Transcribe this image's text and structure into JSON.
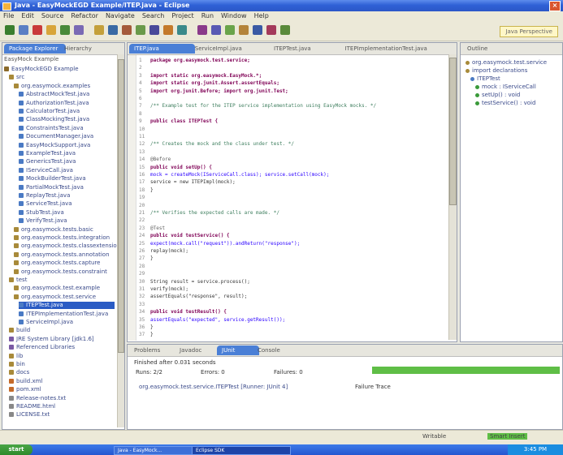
{
  "window": {
    "title": "Java - EasyMockEGD Example/ITEP.java - Eclipse",
    "close_glyph": "×"
  },
  "menu": [
    "File",
    "Edit",
    "Source",
    "Refactor",
    "Navigate",
    "Search",
    "Project",
    "Run",
    "Window",
    "Help"
  ],
  "toolbar": {
    "perspective_label": "Java Perspective",
    "button_colors": [
      "#3b7f2e",
      "#5a7fc4",
      "#c93a3a",
      "#d8a53a",
      "#4a8a3a",
      "#7a6ab4",
      "#c4a03a",
      "#3a6aa4",
      "#a45a3a",
      "#6a9a4a",
      "#4a4a9a",
      "#c47a2a",
      "#3a8a8a",
      "#8a3a8a",
      "#5a5ab4",
      "#6aa44a",
      "#b4843a",
      "#3a5aa4",
      "#a43a5a",
      "#5a8a3a"
    ]
  },
  "left_panel": {
    "tabs": [
      "Package Explorer",
      "Hierarchy"
    ],
    "header": "EasyMock Example",
    "tree": [
      {
        "label": "EasyMockEGD Example",
        "indent": 0,
        "color": "#8a6a2a"
      },
      {
        "label": "src",
        "indent": 1,
        "color": "#a88a3a"
      },
      {
        "label": "org.easymock.examples",
        "indent": 2,
        "color": "#a88a3a"
      },
      {
        "label": "AbstractMockTest.java",
        "indent": 3,
        "color": "#4a7ac4"
      },
      {
        "label": "AuthorizationTest.java",
        "indent": 3,
        "color": "#4a7ac4"
      },
      {
        "label": "CalculatorTest.java",
        "indent": 3,
        "color": "#4a7ac4"
      },
      {
        "label": "ClassMockingTest.java",
        "indent": 3,
        "color": "#4a7ac4"
      },
      {
        "label": "ConstraintsTest.java",
        "indent": 3,
        "color": "#4a7ac4"
      },
      {
        "label": "DocumentManager.java",
        "indent": 3,
        "color": "#4a7ac4"
      },
      {
        "label": "EasyMockSupport.java",
        "indent": 3,
        "color": "#4a7ac4"
      },
      {
        "label": "ExampleTest.java",
        "indent": 3,
        "color": "#4a7ac4"
      },
      {
        "label": "GenericsTest.java",
        "indent": 3,
        "color": "#4a7ac4"
      },
      {
        "label": "IServiceCall.java",
        "indent": 3,
        "color": "#4a7ac4"
      },
      {
        "label": "MockBuilderTest.java",
        "indent": 3,
        "color": "#4a7ac4"
      },
      {
        "label": "PartialMockTest.java",
        "indent": 3,
        "color": "#4a7ac4"
      },
      {
        "label": "ReplayTest.java",
        "indent": 3,
        "color": "#4a7ac4"
      },
      {
        "label": "ServiceTest.java",
        "indent": 3,
        "color": "#4a7ac4"
      },
      {
        "label": "StubTest.java",
        "indent": 3,
        "color": "#4a7ac4"
      },
      {
        "label": "VerifyTest.java",
        "indent": 3,
        "color": "#4a7ac4"
      },
      {
        "label": "org.easymock.tests.basic",
        "indent": 2,
        "color": "#a88a3a"
      },
      {
        "label": "org.easymock.tests.integration",
        "indent": 2,
        "color": "#a88a3a"
      },
      {
        "label": "org.easymock.tests.classextension",
        "indent": 2,
        "color": "#a88a3a"
      },
      {
        "label": "org.easymock.tests.annotation",
        "indent": 2,
        "color": "#a88a3a"
      },
      {
        "label": "org.easymock.tests.capture",
        "indent": 2,
        "color": "#a88a3a"
      },
      {
        "label": "org.easymock.tests.constraint",
        "indent": 2,
        "color": "#a88a3a"
      },
      {
        "label": "test",
        "indent": 1,
        "color": "#a88a3a"
      },
      {
        "label": "org.easymock.test.example",
        "indent": 2,
        "color": "#a88a3a"
      },
      {
        "label": "org.easymock.test.service",
        "indent": 2,
        "color": "#a88a3a"
      },
      {
        "label": "ITEPTest.java",
        "indent": 3,
        "color": "#4a7ac4",
        "selected": true
      },
      {
        "label": "ITEPImplementationTest.java",
        "indent": 3,
        "color": "#4a7ac4"
      },
      {
        "label": "ServiceImpl.java",
        "indent": 3,
        "color": "#4a7ac4"
      },
      {
        "label": "build",
        "indent": 1,
        "color": "#a88a3a"
      },
      {
        "label": "JRE System Library [jdk1.6]",
        "indent": 1,
        "color": "#7a5aa4"
      },
      {
        "label": "Referenced Libraries",
        "indent": 1,
        "color": "#7a5aa4"
      },
      {
        "label": "lib",
        "indent": 1,
        "color": "#a88a3a"
      },
      {
        "label": "bin",
        "indent": 1,
        "color": "#a88a3a"
      },
      {
        "label": "docs",
        "indent": 1,
        "color": "#a88a3a"
      },
      {
        "label": "build.xml",
        "indent": 1,
        "color": "#c46a2a"
      },
      {
        "label": "pom.xml",
        "indent": 1,
        "color": "#c46a2a"
      },
      {
        "label": "Release-notes.txt",
        "indent": 1,
        "color": "#888"
      },
      {
        "label": "README.html",
        "indent": 1,
        "color": "#888"
      },
      {
        "label": "LICENSE.txt",
        "indent": 1,
        "color": "#888"
      }
    ]
  },
  "editor": {
    "tabs": [
      "ITEP.java",
      "ServiceImpl.java",
      "ITEPTest.java",
      "ITEPImplementationTest.java"
    ],
    "lines": [
      {
        "n": "1",
        "cls": "c-key",
        "text": "package org.easymock.test.service;"
      },
      {
        "n": "2",
        "cls": "c-def",
        "text": ""
      },
      {
        "n": "3",
        "cls": "c-key",
        "text": "import static org.easymock.EasyMock.*;"
      },
      {
        "n": "4",
        "cls": "c-key",
        "text": "import static org.junit.Assert.assertEquals;"
      },
      {
        "n": "5",
        "cls": "c-key",
        "text": "import org.junit.Before;   import org.junit.Test;"
      },
      {
        "n": "6",
        "cls": "c-def",
        "text": ""
      },
      {
        "n": "7",
        "cls": "c-comment",
        "text": "/** Example test for the ITEP service implementation using EasyMock mocks. */"
      },
      {
        "n": "8",
        "cls": "c-def",
        "text": ""
      },
      {
        "n": "9",
        "cls": "c-key",
        "text": "public class ITEPTest {"
      },
      {
        "n": "10",
        "cls": "c-def",
        "text": ""
      },
      {
        "n": "11",
        "cls": "c-def",
        "text": ""
      },
      {
        "n": "12",
        "cls": "c-comment",
        "text": "  /** Creates the mock and the class under test. */"
      },
      {
        "n": "13",
        "cls": "c-def",
        "text": ""
      },
      {
        "n": "14",
        "cls": "c-anno",
        "text": "  @Before"
      },
      {
        "n": "15",
        "cls": "c-key",
        "text": "  public void setUp() {"
      },
      {
        "n": "16",
        "cls": "c-str",
        "text": "    mock = createMock(IServiceCall.class); service.setCall(mock);"
      },
      {
        "n": "17",
        "cls": "c-def",
        "text": "    service = new ITEPImpl(mock);"
      },
      {
        "n": "18",
        "cls": "c-def",
        "text": "  }"
      },
      {
        "n": "19",
        "cls": "c-def",
        "text": ""
      },
      {
        "n": "20",
        "cls": "c-def",
        "text": ""
      },
      {
        "n": "21",
        "cls": "c-comment",
        "text": "  /** Verifies the expected calls are made. */"
      },
      {
        "n": "22",
        "cls": "c-def",
        "text": ""
      },
      {
        "n": "23",
        "cls": "c-anno",
        "text": "  @Test"
      },
      {
        "n": "24",
        "cls": "c-key",
        "text": "  public void testService() {"
      },
      {
        "n": "25",
        "cls": "c-str",
        "text": "    expect(mock.call(\"request\")).andReturn(\"response\");"
      },
      {
        "n": "26",
        "cls": "c-def",
        "text": "    replay(mock);"
      },
      {
        "n": "27",
        "cls": "c-def",
        "text": "  }"
      },
      {
        "n": "28",
        "cls": "c-def",
        "text": ""
      },
      {
        "n": "29",
        "cls": "c-def",
        "text": ""
      },
      {
        "n": "30",
        "cls": "c-def",
        "text": "    String result = service.process();"
      },
      {
        "n": "31",
        "cls": "c-def",
        "text": "    verify(mock);"
      },
      {
        "n": "32",
        "cls": "c-def",
        "text": "    assertEquals(\"response\", result);"
      },
      {
        "n": "33",
        "cls": "c-def",
        "text": ""
      },
      {
        "n": "34",
        "cls": "c-key",
        "text": "    public void testResult() {"
      },
      {
        "n": "35",
        "cls": "c-str",
        "text": "      assertEquals(\"expected\", service.getResult());"
      },
      {
        "n": "36",
        "cls": "c-def",
        "text": "    }"
      },
      {
        "n": "37",
        "cls": "c-def",
        "text": "}"
      }
    ]
  },
  "outline": {
    "tabs": [
      "Outline"
    ],
    "rows": [
      {
        "label": "org.easymock.test.service",
        "color": "#a88a3a"
      },
      {
        "label": "import declarations",
        "color": "#a88a3a"
      },
      {
        "label": "ITEPTest",
        "color": "#4a7ac4"
      },
      {
        "label": "mock : IServiceCall",
        "color": "#3a9a3a"
      },
      {
        "label": "setUp() : void",
        "color": "#3a9a3a"
      },
      {
        "label": "testService() : void",
        "color": "#3a9a3a"
      }
    ]
  },
  "bottom": {
    "tabs": [
      "Problems",
      "Javadoc",
      "JUnit",
      "Console"
    ],
    "summary": "Finished after 0.031 seconds",
    "runs_label": "Runs: 2/2",
    "errors_label": "Errors: 0",
    "failures_label": "Failures: 0",
    "trace_row": "org.easymock.test.service.ITEPTest [Runner: JUnit 4]",
    "failure_trace": "Failure Trace"
  },
  "status": {
    "writable": "Writable",
    "insert": "Smart Insert"
  },
  "taskbar": {
    "start": "start",
    "items": [
      "Java - EasyMock...",
      "Eclipse SDK"
    ],
    "clock": "3:45 PM"
  }
}
